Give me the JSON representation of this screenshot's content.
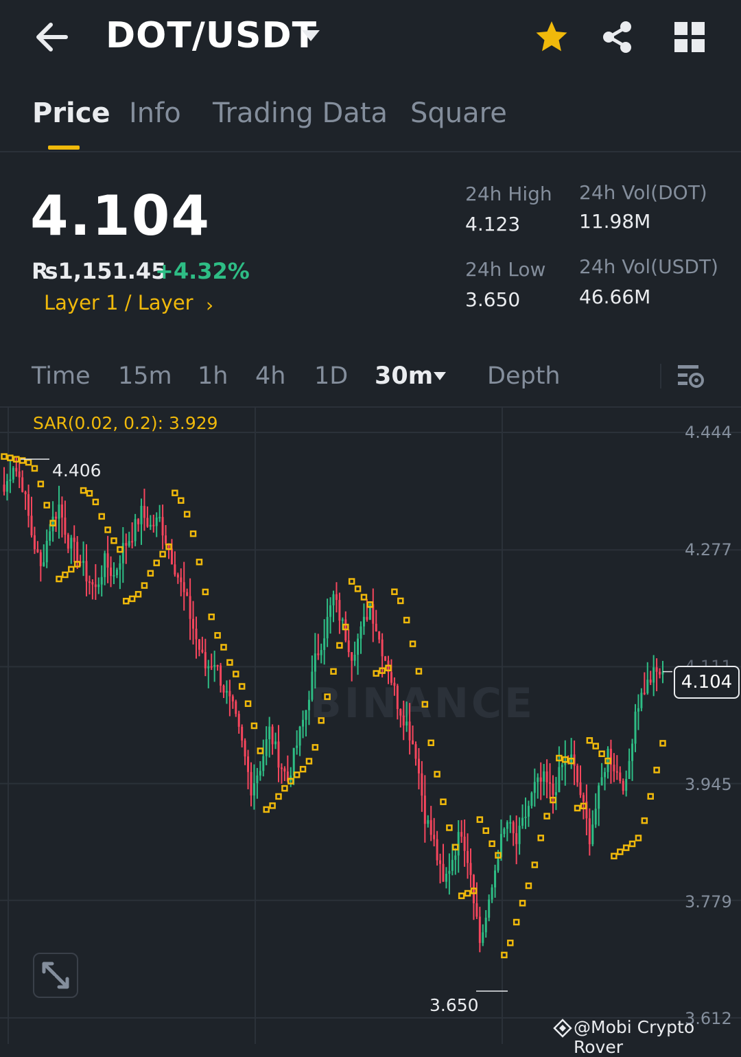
{
  "header": {
    "title": "DOT/USDT",
    "icons": {
      "back": "arrow-left-icon",
      "pair_dropdown": "caret-down-icon",
      "favorite": "star-icon",
      "share": "share-icon",
      "more": "grid-icon"
    },
    "favorite_color": "#f0b90b"
  },
  "tabs": [
    {
      "label": "Price",
      "active": true
    },
    {
      "label": "Info",
      "active": false
    },
    {
      "label": "Trading Data",
      "active": false
    },
    {
      "label": "Square",
      "active": false
    }
  ],
  "ticker": {
    "last_price": "4.104",
    "fiat_price": "₨1,151.45",
    "change_pct": "+4.32%",
    "category": "Layer 1 / Layer",
    "stats": {
      "high_label": "24h High",
      "high_value": "4.123",
      "low_label": "24h Low",
      "low_value": "3.650",
      "vol_base_label": "24h Vol(DOT)",
      "vol_base_value": "11.98M",
      "vol_quote_label": "24h Vol(USDT)",
      "vol_quote_value": "46.66M"
    }
  },
  "intervals": {
    "items": [
      "Time",
      "15m",
      "1h",
      "4h",
      "1D"
    ],
    "selected": "30m",
    "depth": "Depth"
  },
  "chart": {
    "indicator": "SAR(0.02, 0.2): 3.929",
    "watermark": "BINANCE",
    "colors": {
      "up": "#2ebd85",
      "down": "#f6465d",
      "sar": "#f0b90b",
      "grid": "#2b3139"
    }
  },
  "chart_data": {
    "type": "candlestick",
    "interval": "30m",
    "y_axis_ticks": [
      "4.444",
      "4.277",
      "4.111",
      "3.945",
      "3.779",
      "3.612"
    ],
    "ylim": [
      3.612,
      4.444
    ],
    "last_price": 4.104,
    "high_marker": "4.406",
    "low_marker": "3.650",
    "indicator": "SAR(0.02, 0.2)",
    "sar_value": 3.929,
    "closes": [
      4.36,
      4.4,
      4.37,
      4.3,
      4.25,
      4.31,
      4.34,
      4.29,
      4.27,
      4.24,
      4.22,
      4.26,
      4.24,
      4.28,
      4.3,
      4.33,
      4.31,
      4.32,
      4.28,
      4.24,
      4.2,
      4.15,
      4.11,
      4.12,
      4.08,
      4.05,
      4.0,
      3.94,
      3.97,
      4.02,
      3.98,
      3.95,
      4.0,
      4.05,
      4.12,
      4.16,
      4.21,
      4.17,
      4.13,
      4.16,
      4.2,
      4.15,
      4.11,
      4.06,
      4.03,
      3.99,
      3.9,
      3.86,
      3.8,
      3.84,
      3.88,
      3.82,
      3.72,
      3.77,
      3.85,
      3.89,
      3.86,
      3.9,
      3.94,
      3.95,
      3.93,
      3.97,
      3.98,
      3.93,
      3.87,
      3.93,
      3.99,
      3.96,
      3.94,
      4.05,
      4.08,
      4.1,
      4.104
    ],
    "credit": "@Mobi Crypto Rover"
  }
}
